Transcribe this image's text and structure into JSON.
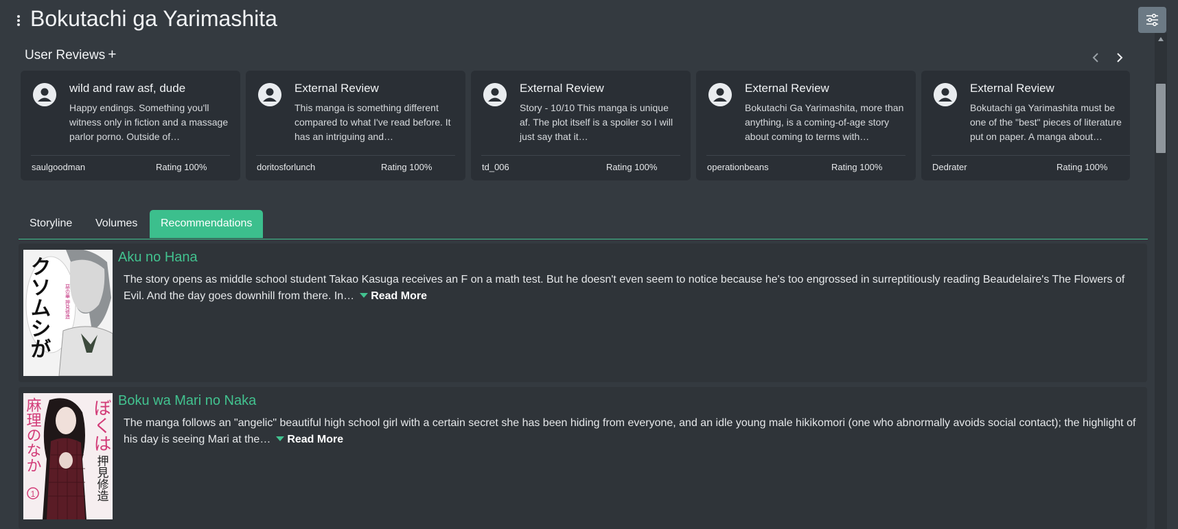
{
  "page": {
    "title": "Bokutachi ga Yarimashita",
    "settings_icon": "sliders-icon",
    "menu_icon": "kebab-menu-icon"
  },
  "reviews": {
    "heading": "User Reviews",
    "add_label": "+",
    "items": [
      {
        "title": "wild and raw asf, dude",
        "body": "Happy endings. Something you'll witness only in fiction and a massage parlor porno. Outside of…",
        "user": "saulgoodman",
        "rating": "Rating 100%"
      },
      {
        "title": "External Review",
        "body": "This manga is something different compared to what I've read before. It has an intriguing and…",
        "user": "doritosforlunch",
        "rating": "Rating 100%"
      },
      {
        "title": "External Review",
        "body": "Story - 10/10 This manga is unique af. The plot itself is a spoiler so I will just say that it…",
        "user": "td_006",
        "rating": "Rating 100%"
      },
      {
        "title": "External Review",
        "body": "Bokutachi Ga Yarimashita, more than anything, is a coming-of-age story about coming to terms with…",
        "user": "operationbeans",
        "rating": "Rating 100%"
      },
      {
        "title": "External Review",
        "body": "Bokutachi ga Yarimashita must be one of the \"best\" pieces of literature put on paper. A manga about…",
        "user": "Dedrater",
        "rating": "Rating 100%"
      }
    ]
  },
  "tabs": [
    {
      "label": "Storyline",
      "active": false
    },
    {
      "label": "Volumes",
      "active": false
    },
    {
      "label": "Recommendations",
      "active": true
    }
  ],
  "recommendations": [
    {
      "title": "Aku no Hana",
      "body": "The story opens as middle school student Takao Kasuga receives an F on a math test. But he doesn't even seem to notice because he's too engrossed in surreptitiously reading Beaudelaire's The Flowers of Evil. And the day goes downhill from there. In…",
      "read_more": "Read More",
      "cover_text": "クソムシが",
      "cover_sub": "惡の華 押見修造"
    },
    {
      "title": "Boku wa Mari no Naka",
      "body": "The manga follows an \"angelic\" beautiful high school girl with a certain secret she has been hiding from everyone, and an idle young male hikikomori (one who abnormally avoids social contact); the highlight of his day is seeing Mari at the…",
      "read_more": "Read More",
      "cover_text": "ぼくは",
      "cover_sub": "麻理のなか",
      "cover_author": "押見修造",
      "cover_volume": "1"
    }
  ],
  "colors": {
    "background": "#343a40",
    "card": "#2a2f35",
    "accent": "#3cbf8d",
    "link": "#42c28f"
  }
}
